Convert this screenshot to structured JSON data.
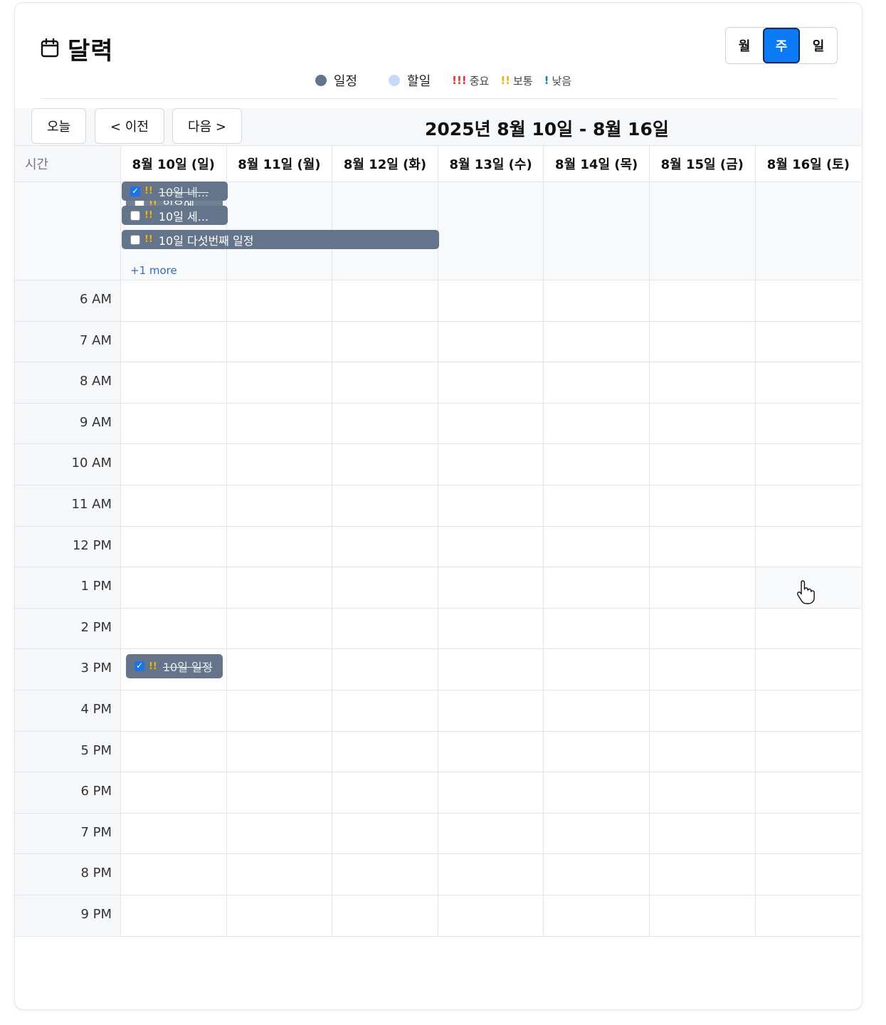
{
  "header": {
    "title": "달력"
  },
  "view_switch": {
    "month": "월",
    "week": "주",
    "day": "일",
    "active": "week"
  },
  "legend": {
    "items": [
      {
        "label": "일정",
        "color": "#64748b"
      },
      {
        "label": "할일",
        "color": "#c6dafc"
      }
    ],
    "priorities": [
      {
        "mark": "!!!",
        "label": "중요",
        "color": "#e5342b"
      },
      {
        "mark": "!!",
        "label": "보통",
        "color": "#f0b400"
      },
      {
        "mark": "!",
        "label": "낮음",
        "color": "#2d6bd6"
      }
    ]
  },
  "nav": {
    "today": "오늘",
    "prev": "< 이전",
    "next": "다음 >"
  },
  "range_label": "2025년 8월 10일 - 8월 16일",
  "columns": {
    "time_header": "시간",
    "days": [
      "8월 10일 (일)",
      "8월 11일 (월)",
      "8월 12일 (화)",
      "8월 13일 (수)",
      "8월 14일 (목)",
      "8월 15일 (금)",
      "8월 16일 (토)"
    ]
  },
  "hours": [
    "6 AM",
    "7 AM",
    "8 AM",
    "9 AM",
    "10 AM",
    "11 AM",
    "12 PM",
    "1 PM",
    "2 PM",
    "3 PM",
    "4 PM",
    "5 PM",
    "6 PM",
    "7 PM",
    "8 PM",
    "9 PM"
  ],
  "allday_events": [
    {
      "title": "10일 네...",
      "done": true,
      "priority": "!!"
    },
    {
      "title": "일유에...",
      "done": false,
      "priority": "!!"
    },
    {
      "title": "10일 세...",
      "done": false,
      "priority": "!!"
    },
    {
      "title": "10일 다섯번째 일정",
      "done": false,
      "priority": "!!"
    }
  ],
  "more_label": "+1 more",
  "timed_events": [
    {
      "title": "10일 일정",
      "done": true,
      "priority": "!!",
      "hour": "3 PM",
      "day": "8월 10일 (일)"
    }
  ],
  "colors": {
    "accent": "#0b7bf5",
    "event_bg": "#64748b"
  }
}
